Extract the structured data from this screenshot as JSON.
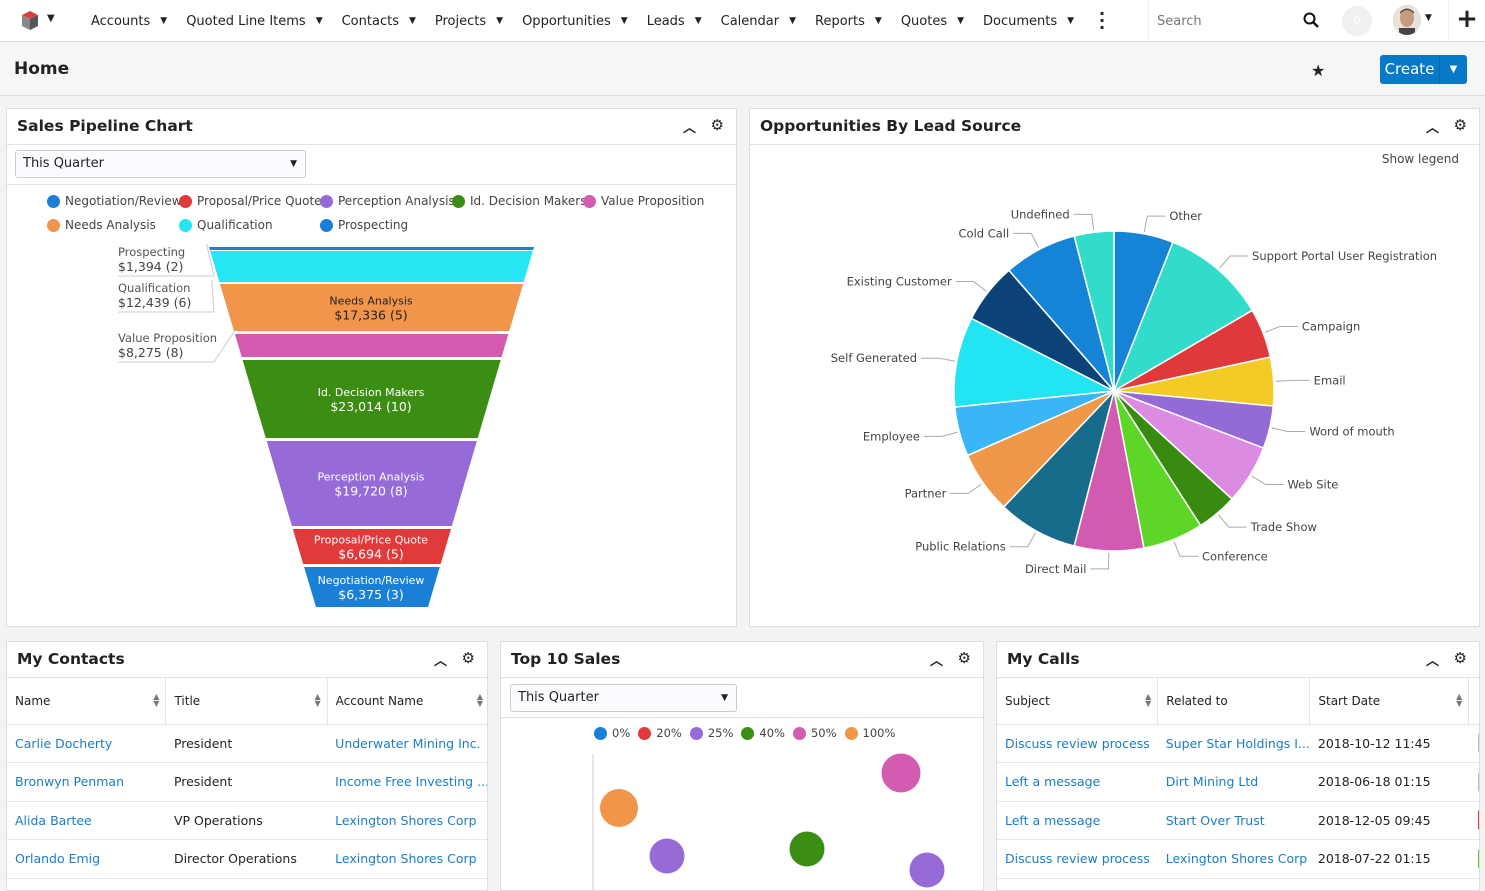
{
  "topbar": {
    "nav": [
      "Accounts",
      "Quoted Line Items",
      "Contacts",
      "Projects",
      "Opportunities",
      "Leads",
      "Calendar",
      "Reports",
      "Quotes",
      "Documents"
    ],
    "search_placeholder": "Search",
    "notifications": "0"
  },
  "header": {
    "title": "Home",
    "create_label": "Create"
  },
  "pipeline": {
    "title": "Sales Pipeline Chart",
    "filter": "This Quarter",
    "chart_data": {
      "type": "funnel",
      "legend": [
        {
          "name": "Negotiation/Review",
          "color": "#1a7fd6"
        },
        {
          "name": "Proposal/Price Quote",
          "color": "#e13a3a"
        },
        {
          "name": "Perception Analysis",
          "color": "#966bd8"
        },
        {
          "name": "Id. Decision Makers",
          "color": "#3b8d14"
        },
        {
          "name": "Value Proposition",
          "color": "#d35bb0"
        },
        {
          "name": "Needs Analysis",
          "color": "#f0954a"
        },
        {
          "name": "Qualification",
          "color": "#25e6f2"
        },
        {
          "name": "Prospecting",
          "color": "#1a7fd6"
        }
      ],
      "stages": [
        {
          "name": "Prospecting",
          "amount": "$1,394",
          "count": 2,
          "value": 1394,
          "color": "#1a7fd6"
        },
        {
          "name": "Qualification",
          "amount": "$12,439",
          "count": 6,
          "value": 12439,
          "color": "#25e6f2"
        },
        {
          "name": "Needs Analysis",
          "amount": "$17,336",
          "count": 5,
          "value": 17336,
          "color": "#f0954a"
        },
        {
          "name": "Value Proposition",
          "amount": "$8,275",
          "count": 8,
          "value": 8275,
          "color": "#d35bb0"
        },
        {
          "name": "Id. Decision Makers",
          "amount": "$23,014",
          "count": 10,
          "value": 23014,
          "color": "#3b8d14"
        },
        {
          "name": "Perception Analysis",
          "amount": "$19,720",
          "count": 8,
          "value": 19720,
          "color": "#966bd8"
        },
        {
          "name": "Proposal/Price Quote",
          "amount": "$6,694",
          "count": 5,
          "value": 6694,
          "color": "#e13a3a"
        },
        {
          "name": "Negotiation/Review",
          "amount": "$6,375",
          "count": 3,
          "value": 6375,
          "color": "#1a7fd6"
        }
      ]
    }
  },
  "leadsource": {
    "title": "Opportunities By Lead Source",
    "show_legend": "Show legend",
    "chart_data": {
      "type": "pie",
      "slices": [
        {
          "name": "Other",
          "value": 6.0,
          "color": "#1584d6"
        },
        {
          "name": "Support Portal User Registration",
          "value": 10.6,
          "color": "#32dccb"
        },
        {
          "name": "Campaign",
          "value": 5.0,
          "color": "#e0393b"
        },
        {
          "name": "Email",
          "value": 4.9,
          "color": "#f3cb24"
        },
        {
          "name": "Word of mouth",
          "value": 4.3,
          "color": "#946ad7"
        },
        {
          "name": "Web Site",
          "value": 6.0,
          "color": "#db8ce2"
        },
        {
          "name": "Trade Show",
          "value": 4.1,
          "color": "#378c10"
        },
        {
          "name": "Conference",
          "value": 6.1,
          "color": "#5ed627"
        },
        {
          "name": "Direct Mail",
          "value": 7.0,
          "color": "#d25bb2"
        },
        {
          "name": "Public Relations",
          "value": 8.1,
          "color": "#176c8b"
        },
        {
          "name": "Partner",
          "value": 6.3,
          "color": "#f09849"
        },
        {
          "name": "Employee",
          "value": 5.0,
          "color": "#3ab5f5"
        },
        {
          "name": "Self Generated",
          "value": 9.1,
          "color": "#22e4f3"
        },
        {
          "name": "Existing Customer",
          "value": 6.1,
          "color": "#0b4277"
        },
        {
          "name": "Cold Call",
          "value": 7.4,
          "color": "#1584d6"
        },
        {
          "name": "Undefined",
          "value": 4.0,
          "color": "#32dccb"
        }
      ]
    }
  },
  "contacts": {
    "title": "My Contacts",
    "columns": [
      "Name",
      "Title",
      "Account Name"
    ],
    "rows": [
      [
        "Carlie Docherty",
        "President",
        "Underwater Mining Inc."
      ],
      [
        "Bronwyn Penman",
        "President",
        "Income Free Investing ..."
      ],
      [
        "Alida Bartee",
        "VP Operations",
        "Lexington Shores Corp"
      ],
      [
        "Orlando Emig",
        "Director Operations",
        "Lexington Shores Corp"
      ]
    ]
  },
  "topsales": {
    "title": "Top 10 Sales",
    "filter": "This Quarter",
    "chart_data": {
      "type": "scatter",
      "legend": [
        {
          "name": "0%",
          "color": "#1a7fd6"
        },
        {
          "name": "20%",
          "color": "#e13a3a"
        },
        {
          "name": "25%",
          "color": "#966bd8"
        },
        {
          "name": "40%",
          "color": "#3b8d14"
        },
        {
          "name": "50%",
          "color": "#d35bb0"
        },
        {
          "name": "100%",
          "color": "#f0954a"
        }
      ],
      "points": [
        {
          "series": "100%",
          "color": "#f0954a"
        },
        {
          "series": "25%",
          "color": "#966bd8"
        },
        {
          "series": "40%",
          "color": "#3b8d14"
        },
        {
          "series": "50%",
          "color": "#d35bb0"
        },
        {
          "series": "25%",
          "color": "#966bd8"
        }
      ]
    }
  },
  "calls": {
    "title": "My Calls",
    "columns": [
      "Subject",
      "Related to",
      "Start Date"
    ],
    "rows": [
      [
        "Discuss review process",
        "Super Star Holdings I...",
        "2018-10-12 11:45"
      ],
      [
        "Left a message",
        "Dirt Mining Ltd",
        "2018-06-18 01:15"
      ],
      [
        "Left a message",
        "Start Over Trust",
        "2018-12-05 09:45"
      ],
      [
        "Discuss review process",
        "Lexington Shores Corp",
        "2018-07-22 01:15"
      ]
    ]
  }
}
